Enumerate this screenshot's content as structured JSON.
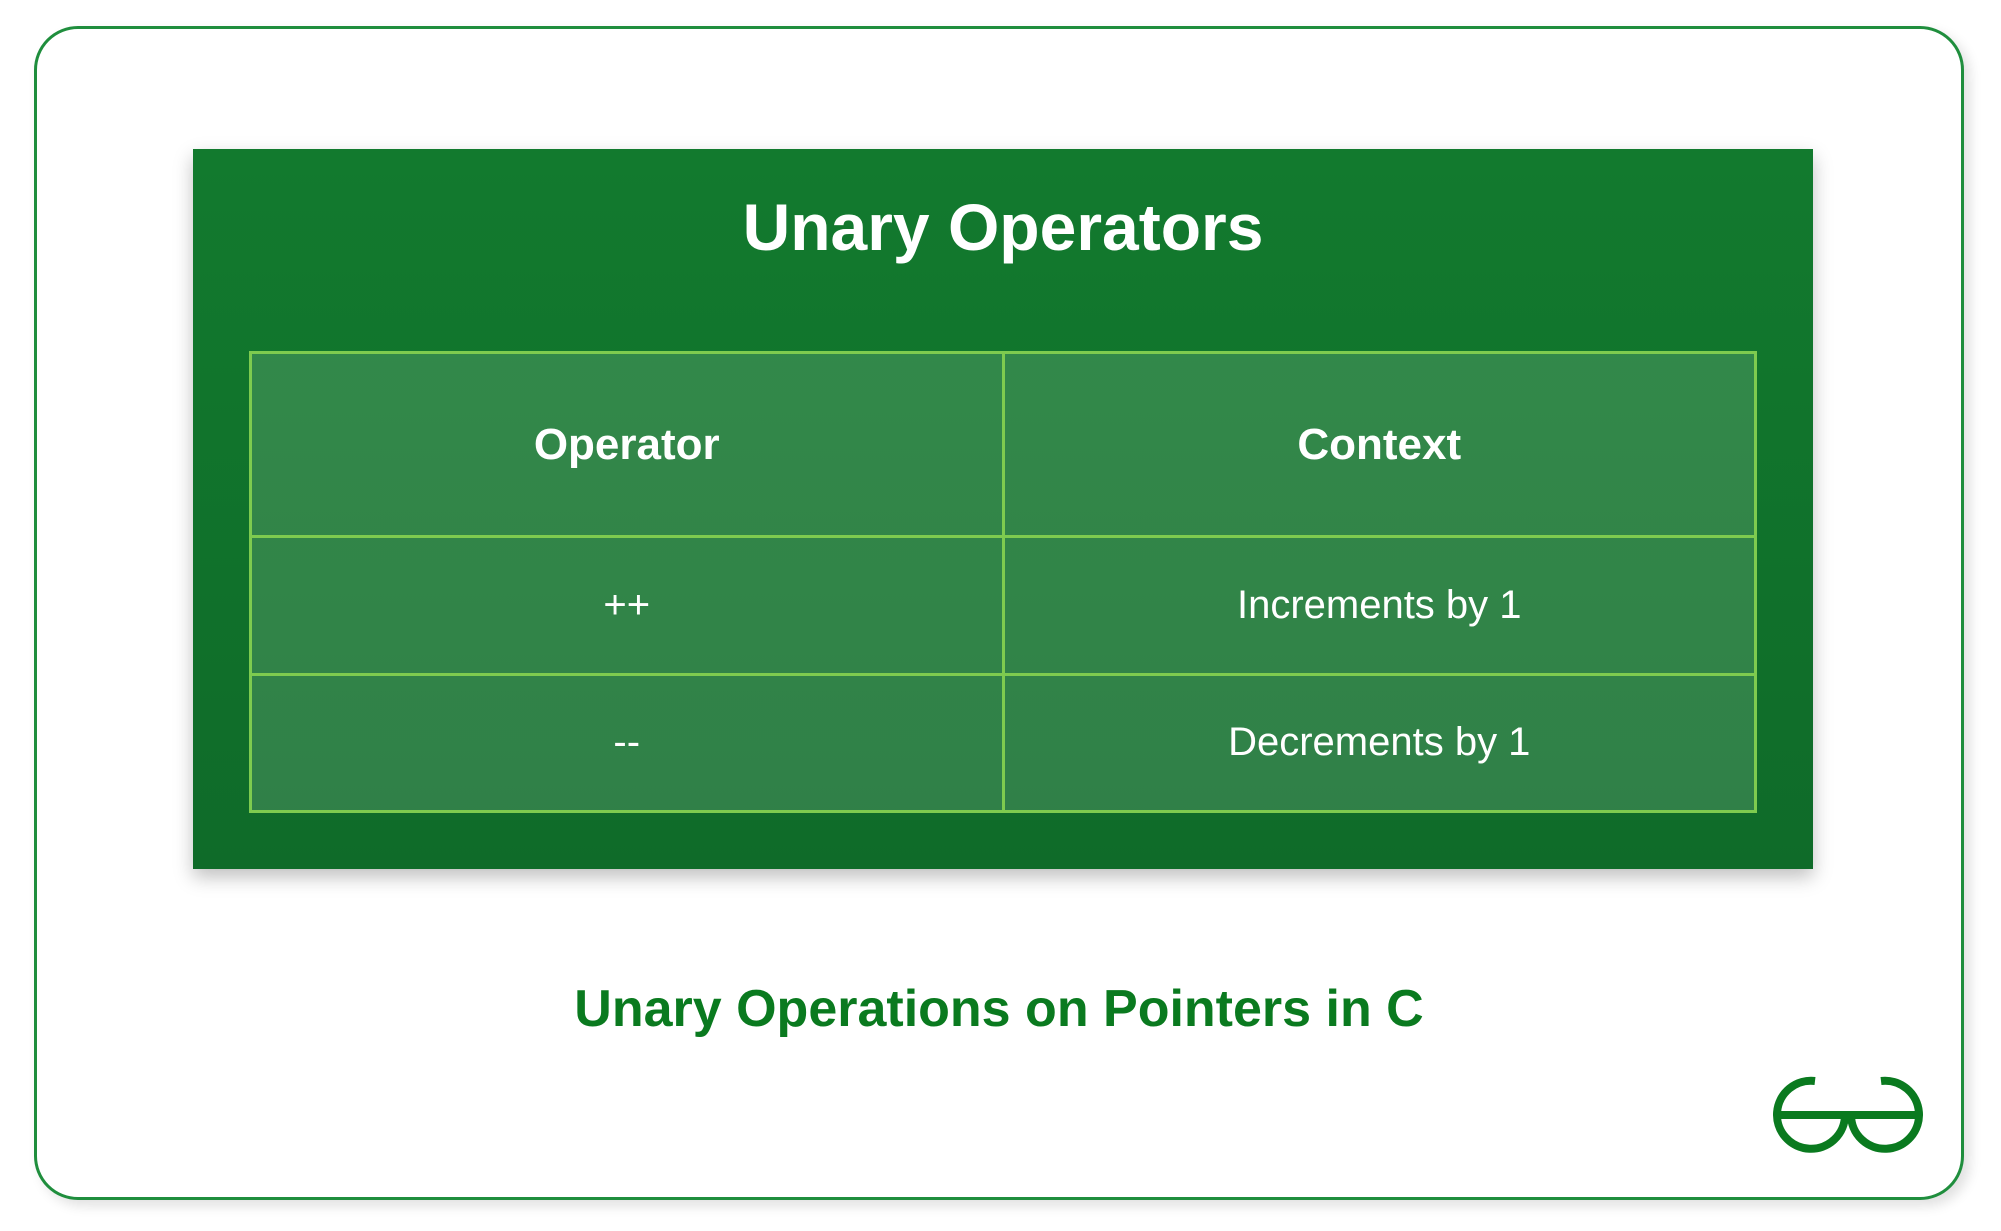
{
  "card": {
    "title": "Unary Operators",
    "headers": [
      "Operator",
      "Context"
    ],
    "rows": [
      {
        "op": "++",
        "ctx": "Increments by 1"
      },
      {
        "op": "--",
        "ctx": "Decrements by 1"
      }
    ]
  },
  "caption": "Unary Operations on Pointers in C",
  "logo_name": "geeksforgeeks-logo",
  "colors": {
    "accent": "#1f8e3d",
    "card_bg_top": "#127a2e",
    "card_bg_bottom": "#0f6b29",
    "table_border": "#7ecb4f",
    "caption_text": "#0a7a1f"
  }
}
